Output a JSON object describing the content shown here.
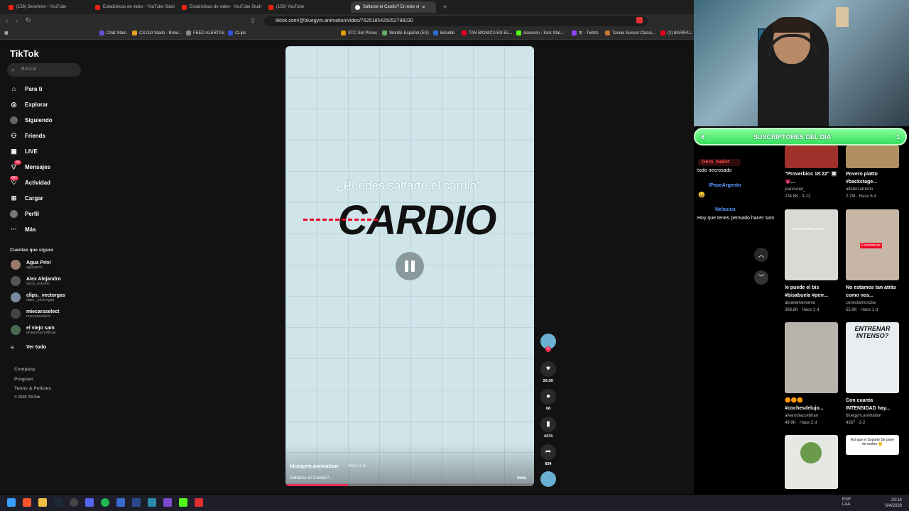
{
  "tabs": [
    {
      "label": "(156) SionAnon - YouTube"
    },
    {
      "label": "Estadísticas de video - YouTube Studi"
    },
    {
      "label": "Estadísticas de video - YouTube Studi"
    },
    {
      "label": "(156) YouTube"
    },
    {
      "label": "Saltarse el Cardio? En este vi"
    }
  ],
  "url": "tiktok.com/@bluegym.animation/video/7625185425052798230",
  "bookmarks": [
    "Chat Stats",
    "CS:GO Stash - Brow...",
    "FEED ALERTAS",
    "CLips",
    "STC Set Prices",
    "Wordle Español (ES)",
    "Boludle",
    "TAN BIONICA EN EL...",
    "sionaron - Kick Stat...",
    "ttr - Twitch",
    "Tanuki Sunset Classi...",
    "(2) BARRA L"
  ],
  "tiktok": {
    "logo": "TikTok",
    "search_placeholder": "Buscar",
    "nav": [
      {
        "label": "Para ti",
        "icon": "home-icon"
      },
      {
        "label": "Explorar",
        "icon": "compass-icon"
      },
      {
        "label": "Siguiendo",
        "icon": "following-icon"
      },
      {
        "label": "Friends",
        "icon": "friends-icon"
      },
      {
        "label": "LIVE",
        "icon": "live-icon"
      },
      {
        "label": "Mensajes",
        "icon": "messages-icon",
        "badge": "99"
      },
      {
        "label": "Actividad",
        "icon": "activity-icon",
        "badge": "99+"
      },
      {
        "label": "Cargar",
        "icon": "upload-icon"
      },
      {
        "label": "Perfil",
        "icon": "profile-icon"
      },
      {
        "label": "Más",
        "icon": "more-icon"
      }
    ],
    "following_title": "Cuentas que sigues",
    "following": [
      {
        "name": "Agus Privi",
        "handle": "aguspirvi"
      },
      {
        "name": "Alex Alejandro",
        "handle": "aoca_estudio"
      },
      {
        "name": "clips._vectorgas",
        "handle": "clips._vectorgas"
      },
      {
        "name": "miecarsselect",
        "handle": "miecarsselect"
      },
      {
        "name": "el viejo sam",
        "handle": "elviejosamofficial"
      }
    ],
    "see_all": "Ver todo",
    "footer": [
      "Company",
      "Program",
      "Terms & Policies",
      "© 2026 TikTok"
    ],
    "video": {
      "question": "¿Puedes saltarte el cardio?",
      "big_word": "CARDIO",
      "author": "bluegym.animation",
      "ago": "Hace 1 d",
      "caption": "Saltarse el Cardio?...",
      "more": "más",
      "progress": 0.25
    },
    "actions": {
      "likes": "26.3K",
      "comments": "68",
      "saves": "4474",
      "shares": "834"
    }
  },
  "stream": {
    "subs_count": "6",
    "subs_label": "SUSCRIPTORES DEL DIA",
    "subs_right": "1",
    "chat": [
      {
        "user": "Gero_Naket",
        "msg": "todo necrosado"
      },
      {
        "user": "IPepeArgento",
        "msg": ""
      },
      {
        "user": "Nelasius",
        "msg": "Hoy que tenes pensado hacer sion"
      }
    ]
  },
  "feed": [
    {
      "desc": "\"Proverbios 18:22\" 🔲 💗...",
      "user": "joancuriel_",
      "stats": "234.8K · 3-12"
    },
    {
      "desc": "Povero piatto #backstage...",
      "user": "alfaterzatrento",
      "stats": "2.7M · Hace 6 d"
    },
    {
      "desc": "le puede el bis #bisabuela #perr...",
      "user": "abuelamamama",
      "stats": "388.8K · Hace 3 d",
      "overlay": "el consentido parte 2"
    },
    {
      "desc": "No estamos tan atrás como nos...",
      "user": "conectamoscba",
      "stats": "55.8K · Hace 1 d",
      "overlay": "Estadísticas"
    },
    {
      "desc": "🟠🟠🟠 #cochesdelujo...",
      "user": "alvarodiazcebrian",
      "stats": "49.9K · Hace 2 d"
    },
    {
      "desc": "Con cuanta INTENSIDAD hay...",
      "user": "bluegym.animation",
      "stats": "4367 · 2-2",
      "overlay": "ENTRENAR INTENSO?"
    },
    {
      "desc": "",
      "user": "",
      "stats": ""
    },
    {
      "desc": "",
      "user": "",
      "stats": "",
      "overlay": "Así que el Soporte Se pone de rusher 🤫"
    }
  ],
  "taskbar": {
    "lang": "ESP\nLAA",
    "time": "20:14",
    "date": "6/4/2026"
  }
}
